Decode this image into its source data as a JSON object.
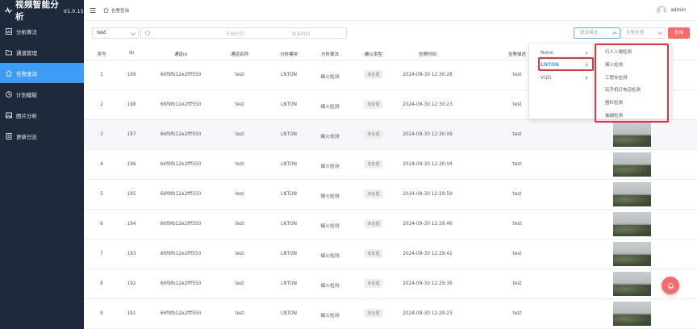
{
  "app": {
    "title": "视频智能分析",
    "version": "V1.0.15"
  },
  "sidebar": {
    "items": [
      {
        "label": "分析算法",
        "icon": "chart-icon"
      },
      {
        "label": "通道管理",
        "icon": "folder-icon"
      },
      {
        "label": "告警查询",
        "icon": "home-icon",
        "active": true
      },
      {
        "label": "计划模版",
        "icon": "clock-icon"
      },
      {
        "label": "图片分析",
        "icon": "image-icon"
      },
      {
        "label": "更新日志",
        "icon": "document-icon"
      }
    ]
  },
  "header": {
    "breadcrumb": "告警查询",
    "user": "admin"
  },
  "filters": {
    "channel": "test",
    "start_placeholder": "开始时间",
    "separator": "-",
    "end_placeholder": "结束时间",
    "module_placeholder": "算法模块",
    "handle_placeholder": "告警处理",
    "query_label": "查询"
  },
  "table": {
    "headers": [
      "序号",
      "ID",
      "通道id",
      "通道名称",
      "分析模块",
      "分析算法",
      "确认类型",
      "告警时间",
      "告警描述"
    ],
    "rows": [
      {
        "index": "1",
        "id": "199",
        "channel_id": "66f9fb12e2fff550",
        "channel_name": "test",
        "module": "LNTON",
        "algorithm": "烟火检测",
        "status": "未处理",
        "time": "2024-09-30 12:30:28",
        "desc": "test"
      },
      {
        "index": "2",
        "id": "198",
        "channel_id": "66f9fb12e2fff550",
        "channel_name": "test",
        "module": "LNTON",
        "algorithm": "烟火检测",
        "status": "未处理",
        "time": "2024-09-30 12:30:23",
        "desc": "test"
      },
      {
        "index": "3",
        "id": "197",
        "channel_id": "66f9fb12e2fff550",
        "channel_name": "test",
        "module": "LNTON",
        "algorithm": "烟火检测",
        "status": "未处理",
        "time": "2024-09-30 12:30:09",
        "desc": "test"
      },
      {
        "index": "4",
        "id": "196",
        "channel_id": "66f9fb12e2fff550",
        "channel_name": "test",
        "module": "LNTON",
        "algorithm": "烟火检测",
        "status": "未处理",
        "time": "2024-09-30 12:30:04",
        "desc": "test"
      },
      {
        "index": "5",
        "id": "195",
        "channel_id": "66f9fb12e2fff550",
        "channel_name": "test",
        "module": "LNTON",
        "algorithm": "烟火检测",
        "status": "未处理",
        "time": "2024-09-30 12:29:59",
        "desc": "test"
      },
      {
        "index": "6",
        "id": "194",
        "channel_id": "66f9fb12e2fff550",
        "channel_name": "test",
        "module": "LNTON",
        "algorithm": "烟火检测",
        "status": "未处理",
        "time": "2024-09-30 12:29:46",
        "desc": "test"
      },
      {
        "index": "7",
        "id": "193",
        "channel_id": "66f9fb12e2fff550",
        "channel_name": "test",
        "module": "LNTON",
        "algorithm": "烟火检测",
        "status": "未处理",
        "time": "2024-09-30 12:29:41",
        "desc": "test"
      },
      {
        "index": "8",
        "id": "192",
        "channel_id": "66f9fb12e2fff550",
        "channel_name": "test",
        "module": "LNTON",
        "algorithm": "烟火检测",
        "status": "未处理",
        "time": "2024-09-30 12:29:36",
        "desc": "test"
      },
      {
        "index": "9",
        "id": "191",
        "channel_id": "66f9fb12e2fff550",
        "channel_name": "test",
        "module": "LNTON",
        "algorithm": "烟火检测",
        "status": "未处理",
        "time": "2024-09-30 12:29:23",
        "desc": "test"
      }
    ]
  },
  "cascader": {
    "level1": [
      "None",
      "LNTON",
      "VQD"
    ],
    "selected": "LNTON",
    "level2": [
      "行人入侵检测",
      "烟火检测",
      "工程车检测",
      "玩手机打电话检测",
      "围栏检测",
      "抽烟检测"
    ]
  },
  "colors": {
    "sidebar_bg": "#1e2a3c",
    "accent": "#3d9df5",
    "danger": "#f56c6c",
    "highlight_border": "#e8323c"
  }
}
